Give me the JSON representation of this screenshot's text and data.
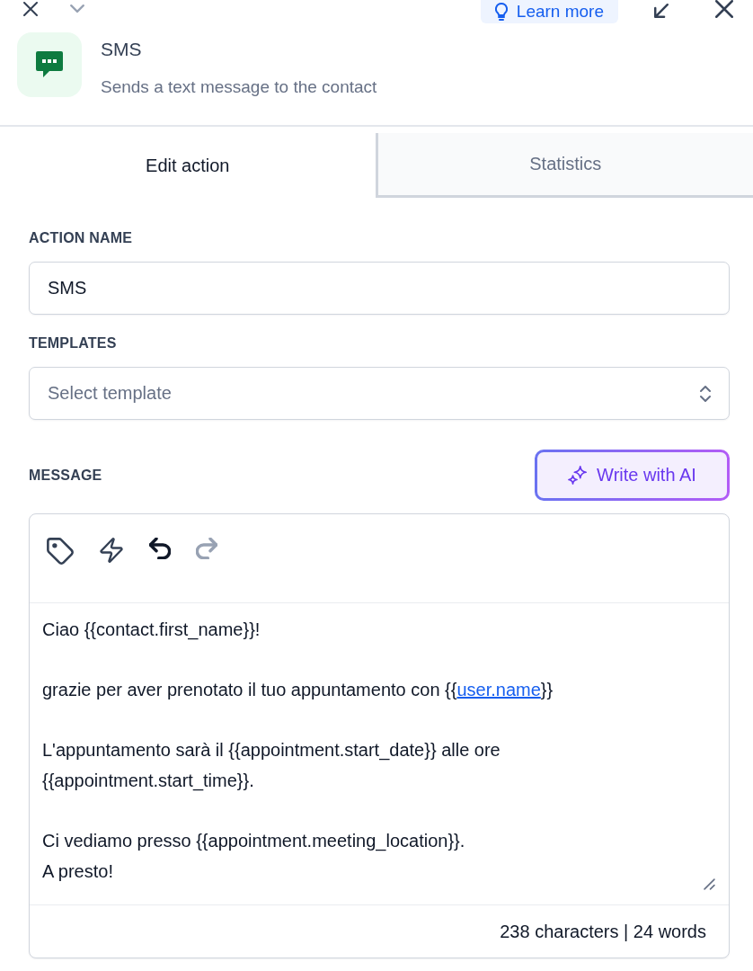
{
  "top_bar": {
    "learn_more": {
      "label": "Learn more"
    }
  },
  "header": {
    "title": "SMS",
    "subtitle": "Sends a text message to the contact"
  },
  "tabs": [
    {
      "label": "Edit action",
      "selected": true
    },
    {
      "label": "Statistics",
      "selected": false
    }
  ],
  "fields": [
    {
      "kind": "input",
      "label": "ACTION NAME",
      "value": "SMS"
    },
    {
      "kind": "select",
      "label": "TEMPLATES",
      "placeholder": "Select template"
    }
  ],
  "message": {
    "label": "MESSAGE",
    "ai_button": {
      "label": "Write with AI"
    },
    "tools": [
      {
        "kind": "tag",
        "disabled": false
      },
      {
        "kind": "bolt",
        "disabled": false
      },
      {
        "kind": "undo",
        "disabled": false
      },
      {
        "kind": "redo",
        "disabled": true
      }
    ],
    "paragraphs": [
      {
        "lines": [
          {
            "parts": [
              {
                "kind": "text",
                "text": "Ciao {{contact.first_name}}!"
              }
            ]
          }
        ]
      },
      {
        "lines": [
          {
            "parts": [
              {
                "kind": "text",
                "text": "grazie per aver prenotato il tuo appuntamento con {{"
              },
              {
                "kind": "link",
                "text": "user.name"
              },
              {
                "kind": "text",
                "text": "}}"
              }
            ]
          }
        ]
      },
      {
        "lines": [
          {
            "parts": [
              {
                "kind": "text",
                "text": "L'appuntamento sarà il {{appointment.start_date}} alle ore {{appointment.start_time}}."
              }
            ]
          }
        ]
      },
      {
        "lines": [
          {
            "parts": [
              {
                "kind": "text",
                "text": "Ci vediamo presso {{appointment.meeting_location}}."
              }
            ]
          },
          {
            "parts": [
              {
                "kind": "text",
                "text": "A presto!"
              }
            ]
          }
        ]
      }
    ],
    "counter": "238 characters | 24 words"
  }
}
